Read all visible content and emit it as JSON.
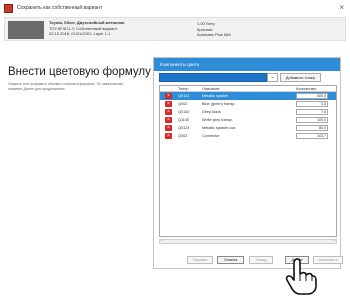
{
  "window": {
    "title": "Сохранить как собственный вариант",
    "close_symbol": "×"
  },
  "header": {
    "product_line1": "Toyota, Silver, Двухслойный металлик",
    "product_line2": "TOY.6F.5C1-Y, Собственный вариант",
    "product_line3": "22.10.2016, 01/01/2001, Layer 1-1",
    "right_line1": "1.00 Литр",
    "right_line2": "Красная",
    "right_line3": "Autobase Plus MM"
  },
  "left": {
    "title": "Внести цветовую формулу",
    "description": "Укажите или исправьте объемы тонеров в формуле. По завершении, нажмите Далее для продолжения."
  },
  "panel": {
    "title": "Компоненты цвета",
    "add_button": "Добавить тонер",
    "columns": {
      "code": "Тонер",
      "description": "Описание",
      "quantity": "Количество"
    },
    "rows": [
      {
        "code": "Q0122",
        "description": "Metallic sparkle",
        "quantity": "600.0"
      },
      {
        "code": "Q002",
        "description": "Blue (green) transp.",
        "quantity": "3.5"
      },
      {
        "code": "Q0140",
        "description": "Deep black",
        "quantity": "7.6"
      },
      {
        "code": "Q1140",
        "description": "White grey transp.",
        "quantity": "100.0"
      },
      {
        "code": "Q0124",
        "description": "Metallic sparkle coa",
        "quantity": "80.0"
      },
      {
        "code": "Q003",
        "description": "Connector",
        "quantity": "103.7"
      }
    ]
  },
  "footer": {
    "b1": "Справка",
    "b2": "Отмена",
    "b3": "Назад",
    "b4": "Далее",
    "b5": "Завершить"
  },
  "colors": {
    "accent": "#2e8dd6",
    "delete": "#d9262a"
  }
}
